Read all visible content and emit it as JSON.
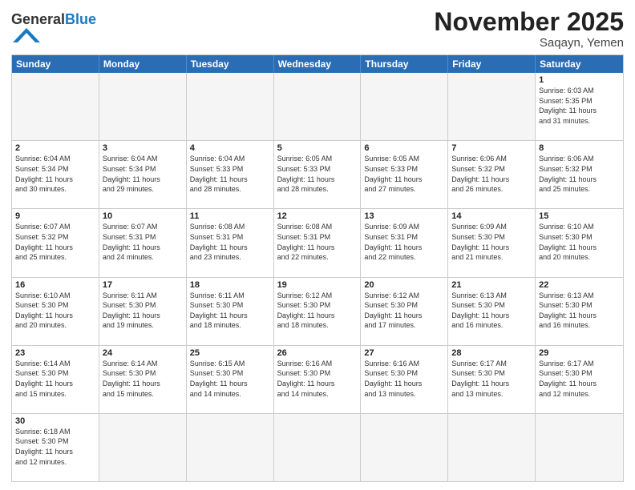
{
  "header": {
    "logo_general": "General",
    "logo_blue": "Blue",
    "month_title": "November 2025",
    "location": "Saqayn, Yemen"
  },
  "weekdays": [
    "Sunday",
    "Monday",
    "Tuesday",
    "Wednesday",
    "Thursday",
    "Friday",
    "Saturday"
  ],
  "weeks": [
    [
      {
        "day": "",
        "info": "",
        "empty": true
      },
      {
        "day": "",
        "info": "",
        "empty": true
      },
      {
        "day": "",
        "info": "",
        "empty": true
      },
      {
        "day": "",
        "info": "",
        "empty": true
      },
      {
        "day": "",
        "info": "",
        "empty": true
      },
      {
        "day": "",
        "info": "",
        "empty": true
      },
      {
        "day": "1",
        "info": "Sunrise: 6:03 AM\nSunset: 5:35 PM\nDaylight: 11 hours\nand 31 minutes.",
        "empty": false
      }
    ],
    [
      {
        "day": "2",
        "info": "Sunrise: 6:04 AM\nSunset: 5:34 PM\nDaylight: 11 hours\nand 30 minutes.",
        "empty": false
      },
      {
        "day": "3",
        "info": "Sunrise: 6:04 AM\nSunset: 5:34 PM\nDaylight: 11 hours\nand 29 minutes.",
        "empty": false
      },
      {
        "day": "4",
        "info": "Sunrise: 6:04 AM\nSunset: 5:33 PM\nDaylight: 11 hours\nand 28 minutes.",
        "empty": false
      },
      {
        "day": "5",
        "info": "Sunrise: 6:05 AM\nSunset: 5:33 PM\nDaylight: 11 hours\nand 28 minutes.",
        "empty": false
      },
      {
        "day": "6",
        "info": "Sunrise: 6:05 AM\nSunset: 5:33 PM\nDaylight: 11 hours\nand 27 minutes.",
        "empty": false
      },
      {
        "day": "7",
        "info": "Sunrise: 6:06 AM\nSunset: 5:32 PM\nDaylight: 11 hours\nand 26 minutes.",
        "empty": false
      },
      {
        "day": "8",
        "info": "Sunrise: 6:06 AM\nSunset: 5:32 PM\nDaylight: 11 hours\nand 25 minutes.",
        "empty": false
      }
    ],
    [
      {
        "day": "9",
        "info": "Sunrise: 6:07 AM\nSunset: 5:32 PM\nDaylight: 11 hours\nand 25 minutes.",
        "empty": false
      },
      {
        "day": "10",
        "info": "Sunrise: 6:07 AM\nSunset: 5:31 PM\nDaylight: 11 hours\nand 24 minutes.",
        "empty": false
      },
      {
        "day": "11",
        "info": "Sunrise: 6:08 AM\nSunset: 5:31 PM\nDaylight: 11 hours\nand 23 minutes.",
        "empty": false
      },
      {
        "day": "12",
        "info": "Sunrise: 6:08 AM\nSunset: 5:31 PM\nDaylight: 11 hours\nand 22 minutes.",
        "empty": false
      },
      {
        "day": "13",
        "info": "Sunrise: 6:09 AM\nSunset: 5:31 PM\nDaylight: 11 hours\nand 22 minutes.",
        "empty": false
      },
      {
        "day": "14",
        "info": "Sunrise: 6:09 AM\nSunset: 5:30 PM\nDaylight: 11 hours\nand 21 minutes.",
        "empty": false
      },
      {
        "day": "15",
        "info": "Sunrise: 6:10 AM\nSunset: 5:30 PM\nDaylight: 11 hours\nand 20 minutes.",
        "empty": false
      }
    ],
    [
      {
        "day": "16",
        "info": "Sunrise: 6:10 AM\nSunset: 5:30 PM\nDaylight: 11 hours\nand 20 minutes.",
        "empty": false
      },
      {
        "day": "17",
        "info": "Sunrise: 6:11 AM\nSunset: 5:30 PM\nDaylight: 11 hours\nand 19 minutes.",
        "empty": false
      },
      {
        "day": "18",
        "info": "Sunrise: 6:11 AM\nSunset: 5:30 PM\nDaylight: 11 hours\nand 18 minutes.",
        "empty": false
      },
      {
        "day": "19",
        "info": "Sunrise: 6:12 AM\nSunset: 5:30 PM\nDaylight: 11 hours\nand 18 minutes.",
        "empty": false
      },
      {
        "day": "20",
        "info": "Sunrise: 6:12 AM\nSunset: 5:30 PM\nDaylight: 11 hours\nand 17 minutes.",
        "empty": false
      },
      {
        "day": "21",
        "info": "Sunrise: 6:13 AM\nSunset: 5:30 PM\nDaylight: 11 hours\nand 16 minutes.",
        "empty": false
      },
      {
        "day": "22",
        "info": "Sunrise: 6:13 AM\nSunset: 5:30 PM\nDaylight: 11 hours\nand 16 minutes.",
        "empty": false
      }
    ],
    [
      {
        "day": "23",
        "info": "Sunrise: 6:14 AM\nSunset: 5:30 PM\nDaylight: 11 hours\nand 15 minutes.",
        "empty": false
      },
      {
        "day": "24",
        "info": "Sunrise: 6:14 AM\nSunset: 5:30 PM\nDaylight: 11 hours\nand 15 minutes.",
        "empty": false
      },
      {
        "day": "25",
        "info": "Sunrise: 6:15 AM\nSunset: 5:30 PM\nDaylight: 11 hours\nand 14 minutes.",
        "empty": false
      },
      {
        "day": "26",
        "info": "Sunrise: 6:16 AM\nSunset: 5:30 PM\nDaylight: 11 hours\nand 14 minutes.",
        "empty": false
      },
      {
        "day": "27",
        "info": "Sunrise: 6:16 AM\nSunset: 5:30 PM\nDaylight: 11 hours\nand 13 minutes.",
        "empty": false
      },
      {
        "day": "28",
        "info": "Sunrise: 6:17 AM\nSunset: 5:30 PM\nDaylight: 11 hours\nand 13 minutes.",
        "empty": false
      },
      {
        "day": "29",
        "info": "Sunrise: 6:17 AM\nSunset: 5:30 PM\nDaylight: 11 hours\nand 12 minutes.",
        "empty": false
      }
    ],
    [
      {
        "day": "30",
        "info": "Sunrise: 6:18 AM\nSunset: 5:30 PM\nDaylight: 11 hours\nand 12 minutes.",
        "empty": false
      },
      {
        "day": "",
        "info": "",
        "empty": true
      },
      {
        "day": "",
        "info": "",
        "empty": true
      },
      {
        "day": "",
        "info": "",
        "empty": true
      },
      {
        "day": "",
        "info": "",
        "empty": true
      },
      {
        "day": "",
        "info": "",
        "empty": true
      },
      {
        "day": "",
        "info": "",
        "empty": true
      }
    ]
  ]
}
